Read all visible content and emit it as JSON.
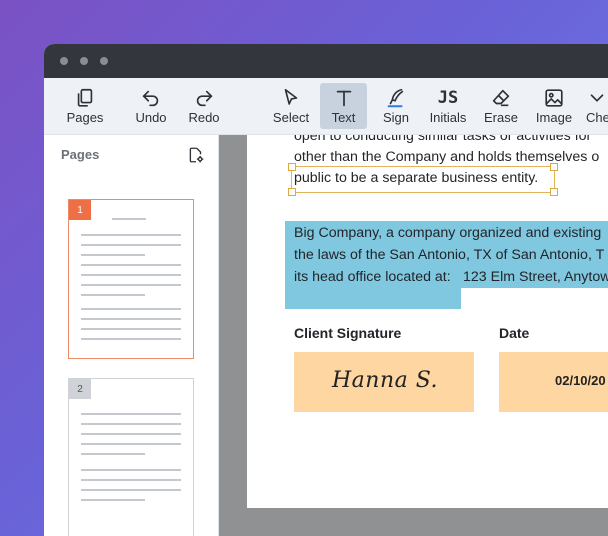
{
  "toolbar": {
    "items": [
      {
        "label": "Pages",
        "icon": "pages-icon"
      },
      {
        "label": "Undo",
        "icon": "undo-icon"
      },
      {
        "label": "Redo",
        "icon": "redo-icon"
      },
      {
        "label": "Select",
        "icon": "cursor-icon"
      },
      {
        "label": "Text",
        "icon": "text-icon",
        "active": true
      },
      {
        "label": "Sign",
        "icon": "pen-icon"
      },
      {
        "label": "Initials",
        "icon": "initials-icon"
      },
      {
        "label": "Erase",
        "icon": "eraser-icon"
      },
      {
        "label": "Image",
        "icon": "image-icon"
      },
      {
        "label": "Che",
        "icon": "check-icon"
      }
    ],
    "initials_glyph": "JS"
  },
  "sidebar": {
    "title": "Pages",
    "thumbs": [
      {
        "number": "1",
        "selected": true
      },
      {
        "number": "2",
        "selected": false
      }
    ]
  },
  "document": {
    "lines_top": [
      "open to conducting similar tasks or activities for",
      "other than the Company and holds themselves o",
      "public to be a separate business entity."
    ],
    "highlight_lines": [
      "Big Company, a company organized and existing",
      "the laws of the San Antonio, TX of San Antonio, T",
      "its head office located at:"
    ],
    "address": "123 Elm Street, Anytow",
    "client_signature_label": "Client Signature",
    "signature_value": "Hanna S.",
    "date_label": "Date",
    "date_value": "02/10/20"
  },
  "colors": {
    "accent_active": "#c8d2df",
    "selected_thumb": "#ef8a66",
    "highlight": "#7fc8df",
    "signature_field": "#fed6a2"
  }
}
